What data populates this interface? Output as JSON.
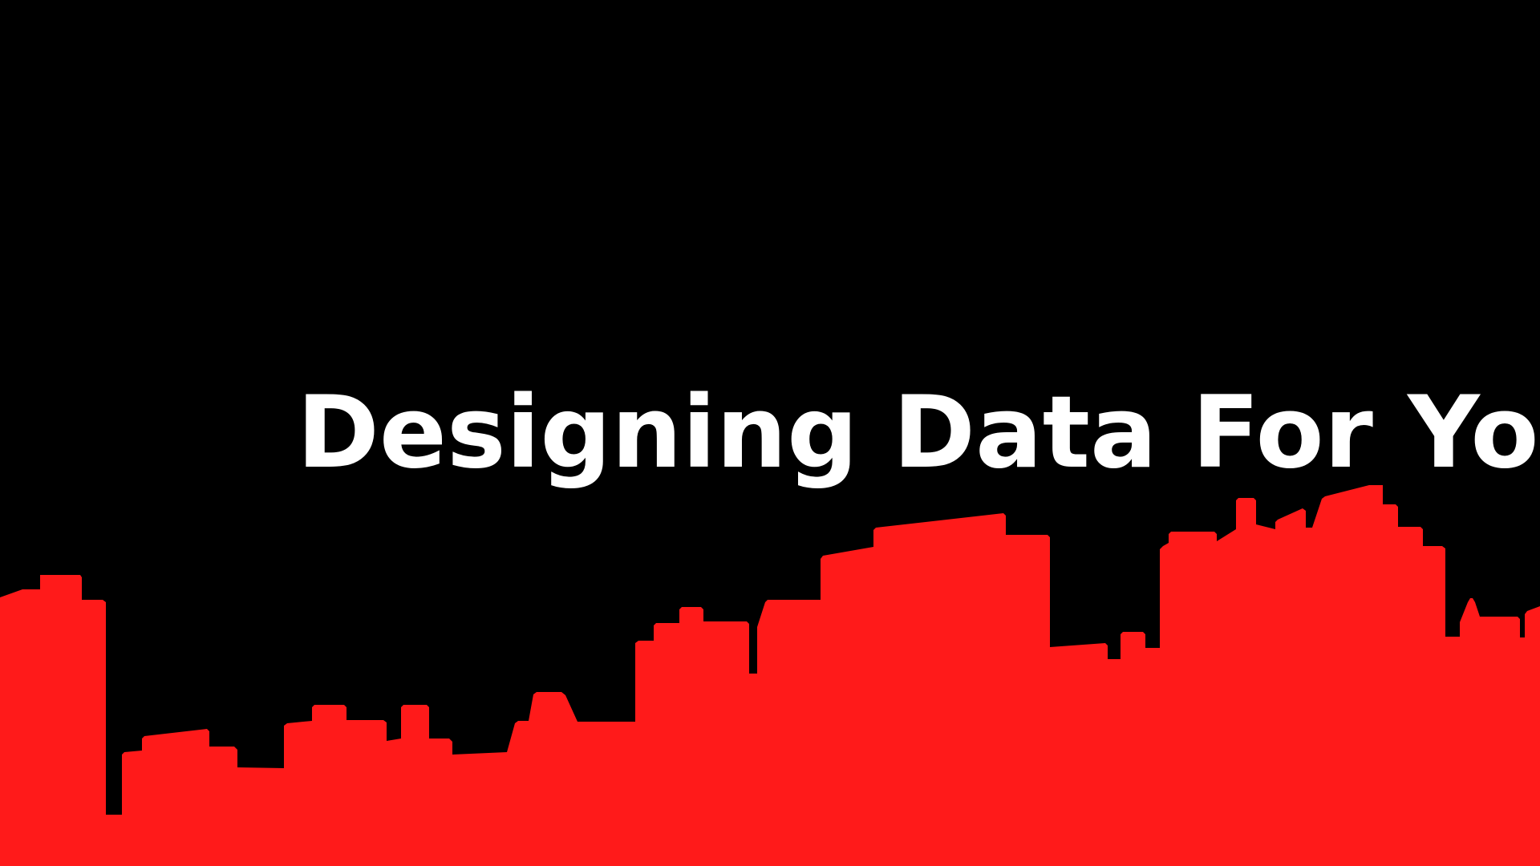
{
  "title": "Designing Data For You",
  "colors": {
    "background": "#000000",
    "skyline": "#ff1a1a",
    "title": "#ffffff"
  }
}
